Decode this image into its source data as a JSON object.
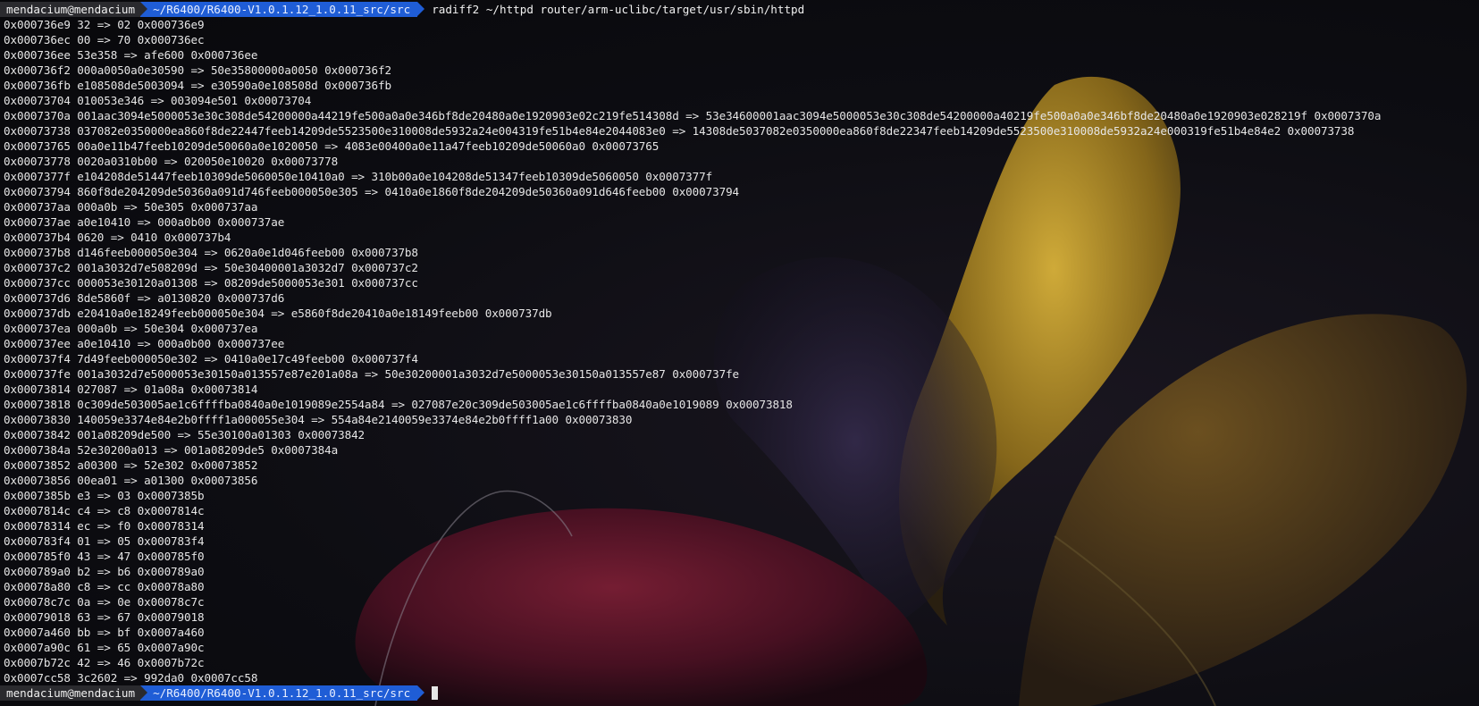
{
  "prompt": {
    "user_host": "mendacium@mendacium",
    "path": "~/R6400/R6400-V1.0.1.12_1.0.11_src/src",
    "command": "radiff2 ~/httpd router/arm-uclibc/target/usr/sbin/httpd"
  },
  "output_lines": [
    "0x000736e9 32 => 02 0x000736e9",
    "0x000736ec 00 => 70 0x000736ec",
    "0x000736ee 53e358 => afe600 0x000736ee",
    "0x000736f2 000a0050a0e30590 => 50e35800000a0050 0x000736f2",
    "0x000736fb e108508de5003094 => e30590a0e108508d 0x000736fb",
    "0x00073704 010053e346 => 003094e501 0x00073704",
    "0x0007370a 001aac3094e5000053e30c308de54200000a44219fe500a0a0e346bf8de20480a0e1920903e02c219fe514308d => 53e34600001aac3094e5000053e30c308de54200000a40219fe500a0a0e346bf8de20480a0e1920903e028219f 0x0007370a",
    "0x00073738 037082e0350000ea860f8de22447feeb14209de5523500e310008de5932a24e004319fe51b4e84e2044083e0 => 14308de5037082e0350000ea860f8de22347feeb14209de5523500e310008de5932a24e000319fe51b4e84e2 0x00073738",
    "0x00073765 00a0e11b47feeb10209de50060a0e1020050 => 4083e00400a0e11a47feeb10209de50060a0 0x00073765",
    "0x00073778 0020a0310b00 => 020050e10020 0x00073778",
    "0x0007377f e104208de51447feeb10309de5060050e10410a0 => 310b00a0e104208de51347feeb10309de5060050 0x0007377f",
    "0x00073794 860f8de204209de50360a091d746feeb000050e305 => 0410a0e1860f8de204209de50360a091d646feeb00 0x00073794",
    "0x000737aa 000a0b => 50e305 0x000737aa",
    "0x000737ae a0e10410 => 000a0b00 0x000737ae",
    "0x000737b4 0620 => 0410 0x000737b4",
    "0x000737b8 d146feeb000050e304 => 0620a0e1d046feeb00 0x000737b8",
    "0x000737c2 001a3032d7e508209d => 50e30400001a3032d7 0x000737c2",
    "0x000737cc 000053e30120a01308 => 08209de5000053e301 0x000737cc",
    "0x000737d6 8de5860f => a0130820 0x000737d6",
    "0x000737db e20410a0e18249feeb000050e304 => e5860f8de20410a0e18149feeb00 0x000737db",
    "0x000737ea 000a0b => 50e304 0x000737ea",
    "0x000737ee a0e10410 => 000a0b00 0x000737ee",
    "0x000737f4 7d49feeb000050e302 => 0410a0e17c49feeb00 0x000737f4",
    "0x000737fe 001a3032d7e5000053e30150a013557e87e201a08a => 50e30200001a3032d7e5000053e30150a013557e87 0x000737fe",
    "0x00073814 027087 => 01a08a 0x00073814",
    "0x00073818 0c309de503005ae1c6ffffba0840a0e1019089e2554a84 => 027087e20c309de503005ae1c6ffffba0840a0e1019089 0x00073818",
    "0x00073830 140059e3374e84e2b0ffff1a000055e304 => 554a84e2140059e3374e84e2b0ffff1a00 0x00073830",
    "0x00073842 001a08209de500 => 55e30100a01303 0x00073842",
    "0x0007384a 52e30200a013 => 001a08209de5 0x0007384a",
    "0x00073852 a00300 => 52e302 0x00073852",
    "0x00073856 00ea01 => a01300 0x00073856",
    "0x0007385b e3 => 03 0x0007385b",
    "0x0007814c c4 => c8 0x0007814c",
    "0x00078314 ec => f0 0x00078314",
    "0x000783f4 01 => 05 0x000783f4",
    "0x000785f0 43 => 47 0x000785f0",
    "0x000789a0 b2 => b6 0x000789a0",
    "0x00078a80 c8 => cc 0x00078a80",
    "0x00078c7c 0a => 0e 0x00078c7c",
    "0x00079018 63 => 67 0x00079018",
    "0x0007a460 bb => bf 0x0007a460",
    "0x0007a90c 61 => 65 0x0007a90c",
    "0x0007b72c 42 => 46 0x0007b72c",
    "0x0007cc58 3c2602 => 992da0 0x0007cc58"
  ],
  "colors": {
    "prompt_user_bg": "#2a2a2e",
    "prompt_path_bg": "#1f5dd6",
    "text": "#e6e6e6"
  }
}
